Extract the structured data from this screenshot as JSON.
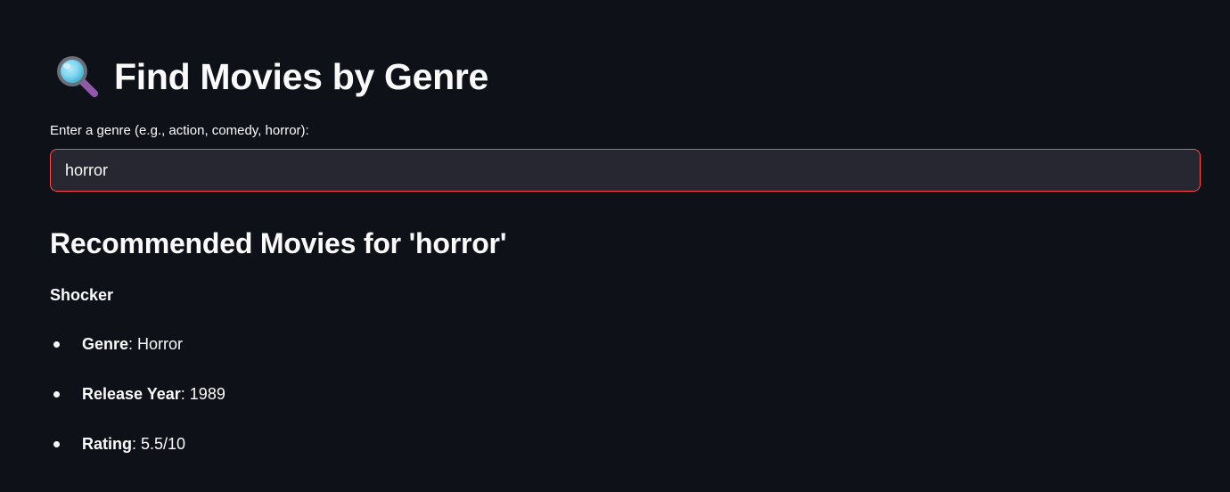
{
  "header": {
    "icon": "magnifying-glass-icon",
    "title": "Find Movies by Genre"
  },
  "search": {
    "label": "Enter a genre (e.g., action, comedy, horror):",
    "value": "horror"
  },
  "results": {
    "heading": "Recommended Movies for 'horror'",
    "movies": [
      {
        "title": "Shocker",
        "details": [
          {
            "key": "Genre",
            "sep": ": ",
            "value": "Horror"
          },
          {
            "key": "Release Year",
            "sep": ": ",
            "value": "1989"
          },
          {
            "key": "Rating",
            "sep": ": ",
            "value": "5.5/10"
          }
        ]
      }
    ]
  },
  "colors": {
    "background": "#0e1117",
    "input_background": "#262730",
    "input_focus_border": "#ff4b4b",
    "text": "#fafafa",
    "icon_lens": "#7fd6f0",
    "icon_handle": "#8e5aa8"
  }
}
